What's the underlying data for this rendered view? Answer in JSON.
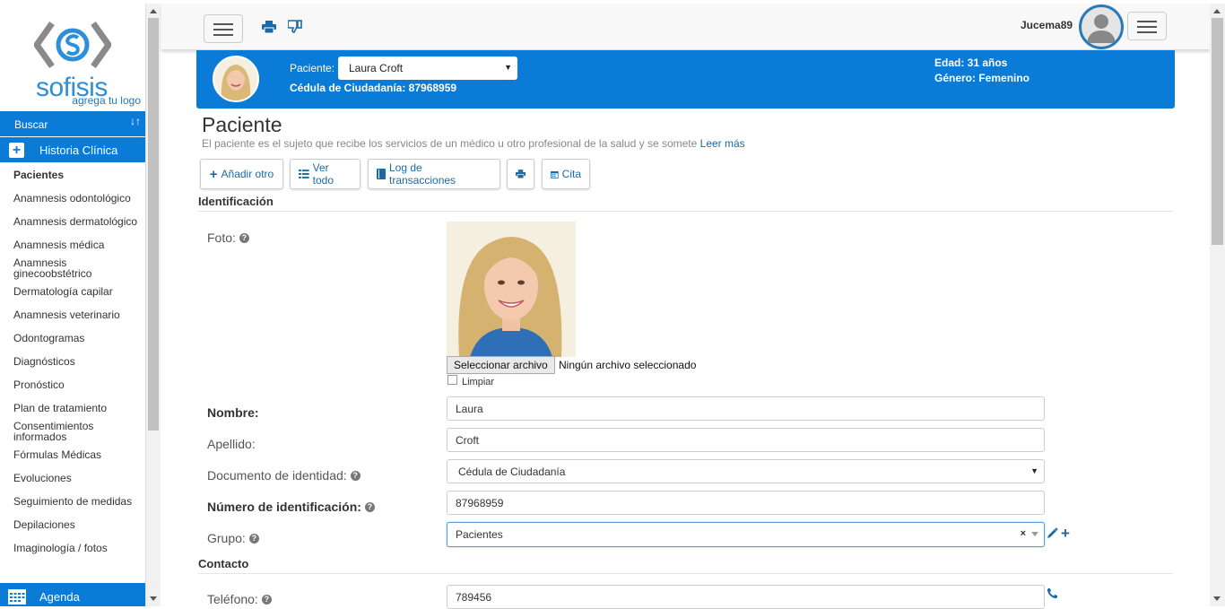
{
  "sidebar": {
    "logo_text": "sofisis",
    "logo_tagline": "agrega tu logo",
    "search_label": "Buscar",
    "section_label": "Historia Clínica",
    "items": [
      {
        "label": "Pacientes",
        "active": true
      },
      {
        "label": "Anamnesis odontológico"
      },
      {
        "label": "Anamnesis dermatológico"
      },
      {
        "label": "Anamnesis médica"
      },
      {
        "label": "Anamnesis ginecoobstétrico"
      },
      {
        "label": "Dermatología capilar"
      },
      {
        "label": "Anamnesis veterinario"
      },
      {
        "label": "Odontogramas"
      },
      {
        "label": "Diagnósticos"
      },
      {
        "label": "Pronóstico"
      },
      {
        "label": "Plan de tratamiento"
      },
      {
        "label": "Consentimientos informados"
      },
      {
        "label": "Fórmulas Médicas"
      },
      {
        "label": "Evoluciones"
      },
      {
        "label": "Seguimiento de medidas"
      },
      {
        "label": "Depilaciones"
      },
      {
        "label": "Imaginología / fotos"
      }
    ],
    "agenda_label": "Agenda"
  },
  "topbar": {
    "username": "Jucema89"
  },
  "banner": {
    "patient_label": "Paciente:",
    "patient_selected": "Laura Croft",
    "cedula": "Cédula de Ciudadanía: 87968959",
    "edad": "Edad: 31 años",
    "genero": "Género: Femenino"
  },
  "page": {
    "title": "Paciente",
    "description": "El paciente es el sujeto que recibe los servicios de un médico u otro profesional de la salud y se somete",
    "read_more": "Leer más"
  },
  "actions": {
    "add_other": "Añadir otro",
    "view_all": "Ver todo",
    "transaction_log": "Log de transacciones",
    "appointment": "Cita"
  },
  "sections": {
    "identification": "Identificación",
    "contact": "Contacto"
  },
  "form": {
    "photo_label": "Foto:",
    "file_button": "Seleccionar archivo",
    "file_status": "Ningún archivo seleccionado",
    "clear_label": "Limpiar",
    "name_label": "Nombre:",
    "name_value": "Laura",
    "lastname_label": "Apellido:",
    "lastname_value": "Croft",
    "doc_label": "Documento de identidad:",
    "doc_value": "Cédula de Ciudadanía",
    "idnum_label": "Número de identificación:",
    "idnum_value": "87968959",
    "group_label": "Grupo:",
    "group_value": "Pacientes",
    "phone_label": "Teléfono:",
    "phone_value": "789456"
  },
  "colors": {
    "brand_blue": "#0a7bd6",
    "link_blue": "#1a6aa8"
  }
}
